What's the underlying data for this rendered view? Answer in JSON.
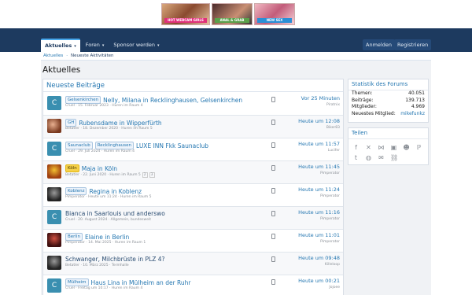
{
  "banner": {
    "ad1_text": "HOT WEBCAM GIRLS",
    "ad2_text": "ANAL & GRAB",
    "ad3_text": "NEW SEX"
  },
  "nav": {
    "tabs": [
      {
        "label": "Aktuelles"
      },
      {
        "label": "Foren"
      },
      {
        "label": "Sponsor werden"
      }
    ],
    "login": "Anmelden",
    "register": "Registrieren"
  },
  "subnav": {
    "a": "Aktuelles",
    "b": "Neueste Aktivitäten"
  },
  "page": {
    "title": "Aktuelles"
  },
  "latest": {
    "heading": "Neueste Beiträge",
    "rows": [
      {
        "avatar": "C",
        "prefixes": [
          "Gelsenkirchen"
        ],
        "title": "Nelly, Milana in Recklinghausen, Gelsenkirchen",
        "meta": "Cruel · 15. Februar 2023 · Huren im Raum 4",
        "when": "Vor 25 Minuten",
        "who": "Piratnix"
      },
      {
        "avatar": "",
        "prefixes": [
          "GH"
        ],
        "title": "Rubensdame in Wipperfürth",
        "meta": "Betatler · 18. Dezember 2020 · Huren im Raum 5",
        "when": "Heute um 12:08",
        "who": "Biker83"
      },
      {
        "avatar": "C",
        "prefixes": [
          "Saunaclub",
          "Recklinghausen"
        ],
        "title": "LUXE INN Fkk Saunaclub",
        "meta": "Cruel · 29. Juli 2024 · Huren im Raum 4",
        "when": "Heute um 11:57",
        "who": "Lucifer"
      },
      {
        "avatar": "",
        "prefixes": [
          "Köln"
        ],
        "title": "Maja in Köln",
        "meta": "Betatler · 22. Juni 2020 · Huren im Raum 5",
        "pages": [
          "2",
          "3"
        ],
        "when": "Heute um 11:45",
        "who": "Pimperator"
      },
      {
        "avatar": "",
        "prefixes": [
          "Koblenz"
        ],
        "title": "Regina in Koblenz",
        "meta": "Pimperator · Heute um 11:24 · Huren im Raum 5",
        "when": "Heute um 11:24",
        "who": "Pimperator"
      },
      {
        "avatar": "C",
        "prefixes": [],
        "title": "Bianca in Saarlouis und anderswo",
        "meta": "Cruel · 20. August 2024 · Allgemein, bundesweit",
        "when": "Heute um 11:16",
        "who": "Pimperator"
      },
      {
        "avatar": "",
        "prefixes": [
          "Berlin"
        ],
        "title": "Elaine in Berlin",
        "meta": "Pimperator · 14. Mai 2025 · Huren im Raum 1",
        "when": "Heute um 11:01",
        "who": "Pimperator"
      },
      {
        "avatar": "",
        "prefixes": [],
        "title": "Schwanger, Milchbrüste in PLZ 4?",
        "meta": "Betatler · 10. März 2025 · Termhalle",
        "when": "Heute um 09:48",
        "who": "Killeloop"
      },
      {
        "avatar": "C",
        "prefixes": [
          "Mülheim"
        ],
        "title": "Haus Lina in Mülheim an der Ruhr",
        "meta": "Cruel · Freitag um 10:17 · Huren im Raum 4",
        "when": "Heute um 00:21",
        "who": "Jojoee"
      }
    ]
  },
  "stats": {
    "heading": "Statistik des Forums",
    "items": [
      {
        "label": "Themen:",
        "value": "40.051"
      },
      {
        "label": "Beiträge:",
        "value": "139.713"
      },
      {
        "label": "Mitglieder:",
        "value": "4.969"
      },
      {
        "label": "Neuestes Mitglied:",
        "value": "mikefunkz"
      }
    ]
  },
  "share": {
    "heading": "Teilen"
  }
}
